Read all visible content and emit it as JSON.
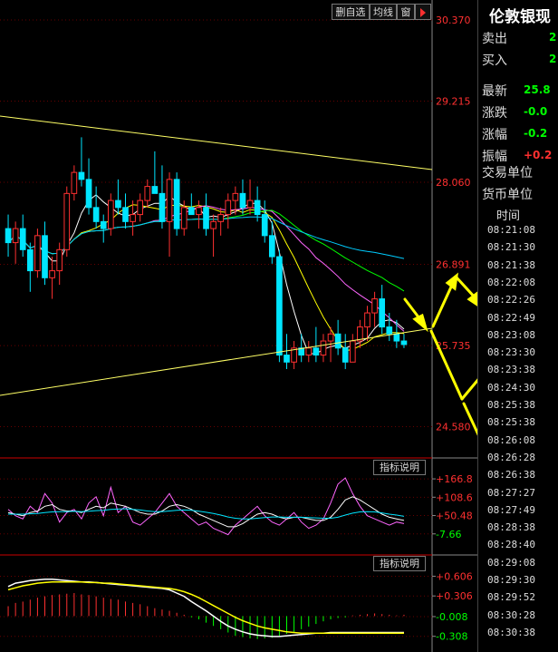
{
  "toolbar": {
    "delete_label": "删自选",
    "avg_label": "均线",
    "window_label": "窗",
    "play_icon": "play-icon"
  },
  "chart_data": [
    {
      "type": "candlestick",
      "name": "main-price",
      "y_ticks": [
        "30.370",
        "29.215",
        "28.060",
        "26.891",
        "25.735",
        "24.580"
      ],
      "ylim": [
        24.2,
        30.37
      ],
      "colors": {
        "up": "#ff3030",
        "down": "#00e5ff",
        "ma5": "#ffffff",
        "ma10": "#ffff00",
        "ma20": "#ff66ff",
        "ma30": "#00ff00",
        "ma60": "#00ccff"
      },
      "candles": [
        [
          27.4,
          27.6,
          27.0,
          27.2
        ],
        [
          27.2,
          27.5,
          26.9,
          27.4
        ],
        [
          27.4,
          27.6,
          27.0,
          27.1
        ],
        [
          27.1,
          27.2,
          26.5,
          26.8
        ],
        [
          26.8,
          27.4,
          26.7,
          27.3
        ],
        [
          27.3,
          27.5,
          26.6,
          26.7
        ],
        [
          26.7,
          27.0,
          26.4,
          26.8
        ],
        [
          26.8,
          27.2,
          26.6,
          27.1
        ],
        [
          27.1,
          28.0,
          27.0,
          27.9
        ],
        [
          27.9,
          28.3,
          27.8,
          28.2
        ],
        [
          28.2,
          28.7,
          28.0,
          28.1
        ],
        [
          28.1,
          28.4,
          27.6,
          27.7
        ],
        [
          27.7,
          28.0,
          27.4,
          27.5
        ],
        [
          27.5,
          27.6,
          27.2,
          27.4
        ],
        [
          27.4,
          27.9,
          27.3,
          27.8
        ],
        [
          27.8,
          28.1,
          27.6,
          27.7
        ],
        [
          27.7,
          27.9,
          27.4,
          27.5
        ],
        [
          27.5,
          27.8,
          27.3,
          27.6
        ],
        [
          27.6,
          27.9,
          27.5,
          27.8
        ],
        [
          27.8,
          28.1,
          27.7,
          28.0
        ],
        [
          28.0,
          28.5,
          27.9,
          27.9
        ],
        [
          27.9,
          28.3,
          27.4,
          27.5
        ],
        [
          27.5,
          28.2,
          27.0,
          28.1
        ],
        [
          28.1,
          28.2,
          27.3,
          27.4
        ],
        [
          27.4,
          27.8,
          27.3,
          27.7
        ],
        [
          27.7,
          27.9,
          27.6,
          27.6
        ],
        [
          27.6,
          27.8,
          27.4,
          27.7
        ],
        [
          27.7,
          27.9,
          27.3,
          27.4
        ],
        [
          27.4,
          27.6,
          27.0,
          27.5
        ],
        [
          27.5,
          27.7,
          27.3,
          27.6
        ],
        [
          27.6,
          27.9,
          27.4,
          27.8
        ],
        [
          27.8,
          28.0,
          27.6,
          27.9
        ],
        [
          27.9,
          28.1,
          27.6,
          27.7
        ],
        [
          27.7,
          28.1,
          27.6,
          27.8
        ],
        [
          27.8,
          28.0,
          27.5,
          27.6
        ],
        [
          27.6,
          27.8,
          27.2,
          27.3
        ],
        [
          27.3,
          27.5,
          26.9,
          27.0
        ],
        [
          27.0,
          27.1,
          25.5,
          25.6
        ],
        [
          25.6,
          25.9,
          25.4,
          25.5
        ],
        [
          25.5,
          25.8,
          25.4,
          25.7
        ],
        [
          25.7,
          25.9,
          25.5,
          25.6
        ],
        [
          25.6,
          25.8,
          25.5,
          25.7
        ],
        [
          25.7,
          26.0,
          25.5,
          25.6
        ],
        [
          25.6,
          25.9,
          25.5,
          25.8
        ],
        [
          25.8,
          26.0,
          25.5,
          25.9
        ],
        [
          25.9,
          26.1,
          25.6,
          25.7
        ],
        [
          25.7,
          25.9,
          25.4,
          25.5
        ],
        [
          25.5,
          25.9,
          25.5,
          25.8
        ],
        [
          25.8,
          26.1,
          25.7,
          26.0
        ],
        [
          26.0,
          26.3,
          25.8,
          26.2
        ],
        [
          26.2,
          26.5,
          26.0,
          26.4
        ],
        [
          26.4,
          26.6,
          25.9,
          26.0
        ],
        [
          26.0,
          26.2,
          25.8,
          25.9
        ],
        [
          25.9,
          26.1,
          25.7,
          25.8
        ],
        [
          25.8,
          25.9,
          25.7,
          25.75
        ]
      ]
    },
    {
      "type": "line",
      "name": "indicator-1",
      "y_ticks": [
        "+166.8",
        "+108.6",
        "+50.48",
        "-7.66"
      ],
      "ylim": [
        -40,
        190
      ],
      "series": [
        {
          "color": "#ff66ff",
          "values": [
            70,
            50,
            40,
            80,
            60,
            120,
            90,
            30,
            60,
            70,
            40,
            90,
            110,
            50,
            140,
            60,
            80,
            30,
            20,
            40,
            60,
            90,
            120,
            80,
            60,
            40,
            20,
            30,
            10,
            0,
            -10,
            20,
            40,
            60,
            80,
            50,
            30,
            20,
            40,
            60,
            30,
            10,
            20,
            40,
            90,
            150,
            170,
            120,
            80,
            50,
            40,
            30,
            20,
            30,
            25
          ]
        },
        {
          "color": "#ffffff",
          "values": [
            60,
            55,
            50,
            60,
            65,
            80,
            85,
            70,
            65,
            65,
            60,
            70,
            80,
            75,
            90,
            85,
            80,
            70,
            60,
            55,
            55,
            65,
            80,
            85,
            80,
            70,
            55,
            45,
            35,
            25,
            15,
            15,
            25,
            40,
            55,
            60,
            55,
            45,
            40,
            45,
            45,
            40,
            35,
            35,
            45,
            70,
            100,
            110,
            100,
            85,
            70,
            55,
            45,
            40,
            35
          ]
        },
        {
          "color": "#00e5ff",
          "values": [
            55,
            55,
            55,
            56,
            57,
            60,
            62,
            63,
            63,
            64,
            63,
            64,
            66,
            67,
            70,
            71,
            72,
            70,
            68,
            65,
            63,
            63,
            65,
            67,
            68,
            67,
            64,
            61,
            57,
            52,
            46,
            42,
            40,
            40,
            42,
            44,
            46,
            46,
            45,
            45,
            45,
            44,
            43,
            42,
            42,
            45,
            52,
            58,
            62,
            63,
            62,
            59,
            55,
            52,
            48
          ]
        }
      ]
    },
    {
      "type": "bar",
      "name": "indicator-2-macd",
      "y_ticks": [
        "+0.606",
        "+0.306",
        "-0.008",
        "-0.308"
      ],
      "ylim": [
        -0.45,
        0.75
      ],
      "histogram": [
        0.15,
        0.2,
        0.22,
        0.25,
        0.28,
        0.3,
        0.32,
        0.33,
        0.34,
        0.35,
        0.33,
        0.32,
        0.3,
        0.28,
        0.26,
        0.25,
        0.22,
        0.2,
        0.18,
        0.15,
        0.12,
        0.1,
        0.08,
        0.05,
        0.02,
        -0.02,
        -0.05,
        -0.1,
        -0.15,
        -0.2,
        -0.25,
        -0.3,
        -0.32,
        -0.34,
        -0.35,
        -0.34,
        -0.33,
        -0.3,
        -0.27,
        -0.24,
        -0.2,
        -0.16,
        -0.12,
        -0.08,
        -0.05,
        -0.03,
        -0.02,
        0.01,
        0.02,
        0.03,
        0.04,
        0.03,
        0.02,
        0.01,
        0.02
      ],
      "dif": [
        0.45,
        0.5,
        0.52,
        0.54,
        0.55,
        0.56,
        0.56,
        0.55,
        0.54,
        0.53,
        0.52,
        0.52,
        0.51,
        0.5,
        0.49,
        0.48,
        0.47,
        0.46,
        0.45,
        0.44,
        0.43,
        0.42,
        0.4,
        0.35,
        0.3,
        0.22,
        0.15,
        0.08,
        0.0,
        -0.08,
        -0.15,
        -0.2,
        -0.24,
        -0.27,
        -0.29,
        -0.3,
        -0.31,
        -0.31,
        -0.3,
        -0.29,
        -0.28,
        -0.27,
        -0.26,
        -0.26,
        -0.25,
        -0.25,
        -0.25,
        -0.25,
        -0.25,
        -0.25,
        -0.25,
        -0.25,
        -0.25,
        -0.25,
        -0.25
      ],
      "dea": [
        0.4,
        0.43,
        0.46,
        0.48,
        0.5,
        0.51,
        0.52,
        0.52,
        0.52,
        0.52,
        0.52,
        0.51,
        0.51,
        0.5,
        0.5,
        0.49,
        0.48,
        0.47,
        0.46,
        0.45,
        0.44,
        0.43,
        0.42,
        0.4,
        0.37,
        0.33,
        0.28,
        0.22,
        0.16,
        0.1,
        0.04,
        -0.02,
        -0.07,
        -0.11,
        -0.15,
        -0.18,
        -0.2,
        -0.22,
        -0.24,
        -0.25,
        -0.26,
        -0.26,
        -0.26,
        -0.26,
        -0.26,
        -0.26,
        -0.26,
        -0.26,
        -0.26,
        -0.26,
        -0.26,
        -0.26,
        -0.26,
        -0.26,
        -0.26
      ]
    }
  ],
  "indicator_tag_1": "指标说明",
  "indicator_tag_2": "指标说明",
  "quote_panel": {
    "title": "伦敦银现",
    "rows": [
      {
        "label": "卖出",
        "value": "2",
        "color": "#00ff00"
      },
      {
        "label": "买入",
        "value": "2",
        "color": "#00ff00"
      },
      {
        "label": "最新",
        "value": "25.8",
        "color": "#00ff00"
      },
      {
        "label": "涨跌",
        "value": "-0.0",
        "color": "#00ff00"
      },
      {
        "label": "涨幅",
        "value": "-0.2",
        "color": "#00ff00"
      },
      {
        "label": "振幅",
        "value": "+0.2",
        "color": "#ff3030"
      }
    ],
    "trade_unit_label": "交易单位",
    "currency_unit_label": "货币单位",
    "time_header": "时间",
    "times": [
      "08:21:08",
      "08:21:30",
      "08:21:38",
      "08:22:08",
      "08:22:26",
      "08:22:49",
      "08:23:08",
      "08:23:30",
      "08:23:38",
      "08:24:30",
      "08:25:38",
      "08:25:38",
      "08:26:08",
      "08:26:28",
      "08:26:38",
      "08:27:27",
      "08:27:49",
      "08:28:38",
      "08:28:40",
      "08:29:08",
      "08:29:30",
      "08:29:52",
      "08:30:28",
      "08:30:38"
    ]
  }
}
